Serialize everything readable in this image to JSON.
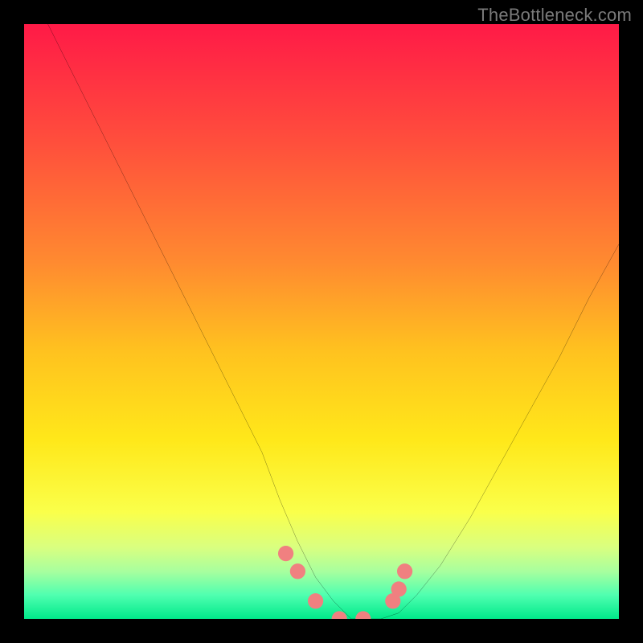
{
  "watermark": "TheBottleneck.com",
  "chart_data": {
    "type": "line",
    "title": "",
    "xlabel": "",
    "ylabel": "",
    "xlim": [
      0,
      100
    ],
    "ylim": [
      0,
      100
    ],
    "grid": false,
    "axes_visible": false,
    "legend": "none",
    "background_gradient": {
      "direction": "vertical",
      "stops": [
        {
          "offset": 0.0,
          "color": "#ff1a47"
        },
        {
          "offset": 0.2,
          "color": "#ff4f3c"
        },
        {
          "offset": 0.4,
          "color": "#ff8a30"
        },
        {
          "offset": 0.55,
          "color": "#ffc21f"
        },
        {
          "offset": 0.7,
          "color": "#ffe81a"
        },
        {
          "offset": 0.82,
          "color": "#faff4a"
        },
        {
          "offset": 0.88,
          "color": "#d9ff80"
        },
        {
          "offset": 0.92,
          "color": "#a8ff9e"
        },
        {
          "offset": 0.96,
          "color": "#4fffb0"
        },
        {
          "offset": 1.0,
          "color": "#00e98a"
        }
      ]
    },
    "series": [
      {
        "name": "bottleneck-curve",
        "color": "#000000",
        "x": [
          4,
          10,
          15,
          20,
          25,
          30,
          35,
          40,
          43,
          46,
          49,
          52,
          55,
          58,
          60,
          63,
          66,
          70,
          75,
          80,
          85,
          90,
          95,
          100
        ],
        "y": [
          100,
          88,
          78,
          68,
          58,
          48,
          38,
          28,
          20,
          13,
          7,
          3,
          0,
          0,
          0,
          1,
          4,
          9,
          17,
          26,
          35,
          44,
          54,
          63
        ]
      },
      {
        "name": "marker-dots",
        "color": "#f08080",
        "type": "scatter",
        "x": [
          44,
          46,
          49,
          53,
          57,
          62,
          63,
          64
        ],
        "y": [
          11,
          8,
          3,
          0,
          0,
          3,
          5,
          8
        ]
      }
    ],
    "annotations": []
  }
}
